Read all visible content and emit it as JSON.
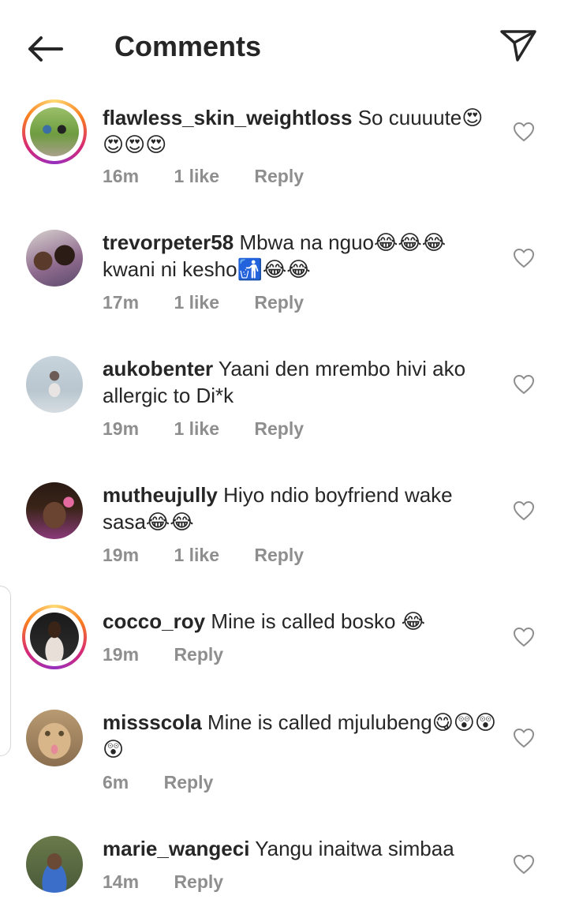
{
  "header": {
    "title": "Comments"
  },
  "comments": [
    {
      "username": "flawless_skin_weightloss",
      "text": "So cuuuute😍😍😍😍",
      "time": "16m",
      "likes": "1 like",
      "reply": "Reply",
      "has_story_ring": true
    },
    {
      "username": "trevorpeter58",
      "text": "Mbwa na nguo😂😂😂 kwani ni kesho🚮😂😂",
      "time": "17m",
      "likes": "1 like",
      "reply": "Reply",
      "has_story_ring": false
    },
    {
      "username": "aukobenter",
      "text": "Yaani den mrembo hivi ako allergic to Di*k",
      "time": "19m",
      "likes": "1 like",
      "reply": "Reply",
      "has_story_ring": false
    },
    {
      "username": "mutheujully",
      "text": "Hiyo ndio boyfriend wake sasa😂😂",
      "time": "19m",
      "likes": "1 like",
      "reply": "Reply",
      "has_story_ring": false
    },
    {
      "username": "cocco_roy",
      "text": "Mine is called bosko 😂",
      "time": "19m",
      "likes": "",
      "reply": "Reply",
      "has_story_ring": true
    },
    {
      "username": "missscola",
      "text": "Mine is called mjulubeng😋😲😲😲",
      "time": "6m",
      "likes": "",
      "reply": "Reply",
      "has_story_ring": false
    },
    {
      "username": "marie_wangeci",
      "text": "Yangu inaitwa simbaa",
      "time": "14m",
      "likes": "",
      "reply": "Reply",
      "has_story_ring": false
    }
  ],
  "icons": {
    "back": "back-arrow-icon",
    "send": "send-icon",
    "like": "heart-outline-icon"
  },
  "colors": {
    "text": "#262626",
    "meta": "#8e8e8e",
    "ring": [
      "#feda75",
      "#fa7e1e",
      "#d62976",
      "#962fbf"
    ]
  }
}
